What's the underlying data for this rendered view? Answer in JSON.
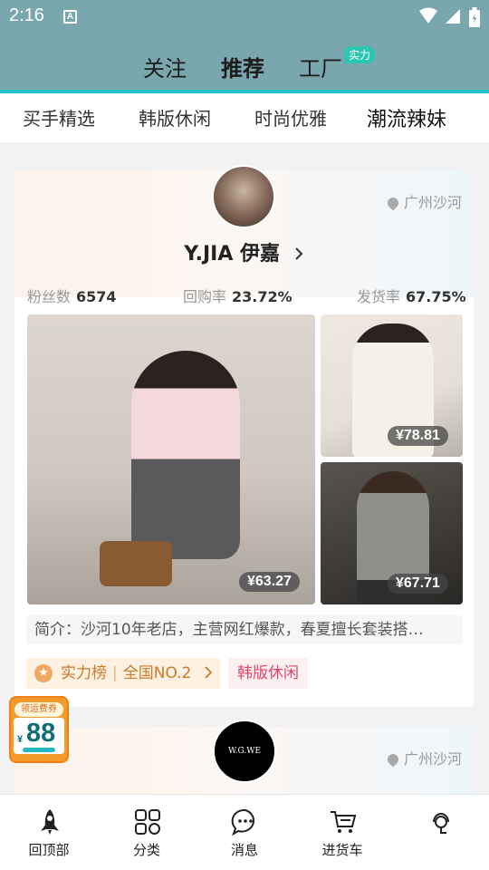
{
  "status_bar": {
    "time": "2:16",
    "notif_icon_letter": "A"
  },
  "top_tabs": [
    {
      "label": "关注"
    },
    {
      "label": "推荐"
    },
    {
      "label": "工厂"
    }
  ],
  "top_badge": "实力",
  "categories": [
    {
      "label": "买手精选"
    },
    {
      "label": "韩版休闲"
    },
    {
      "label": "时尚优雅"
    },
    {
      "label": "潮流辣妹"
    }
  ],
  "shop": {
    "location": "广州沙河",
    "name": "Y.JIA 伊嘉",
    "stats": [
      {
        "label": "粉丝数",
        "value": "6574"
      },
      {
        "label": "回购率",
        "value": "23.72%"
      },
      {
        "label": "发货率",
        "value": "67.75%"
      }
    ],
    "products": [
      {
        "price": "¥63.27"
      },
      {
        "price": "¥78.81"
      },
      {
        "price": "¥67.71"
      }
    ],
    "intro": "简介：沙河10年老店，主营网红爆款，春夏擅长套装搭…",
    "rank_label": "实力榜",
    "rank_value": "全国NO.2",
    "style_tag": "韩版休闲"
  },
  "shop2": {
    "avatar_text": "W.G.WE",
    "location": "广州沙河"
  },
  "coupon": {
    "title": "领运费券",
    "currency": "¥",
    "amount": "88"
  },
  "bottom_nav": [
    {
      "label": "回顶部",
      "icon": "rocket-icon"
    },
    {
      "label": "分类",
      "icon": "category-icon"
    },
    {
      "label": "消息",
      "icon": "message-icon"
    },
    {
      "label": "进货车",
      "icon": "cart-icon"
    },
    {
      "label": "",
      "icon": "service-icon"
    }
  ],
  "colors": {
    "header_bg": "#7aa6ad",
    "accent_teal": "#26c1c4",
    "rank_orange": "#c97a2a",
    "tag_pink": "#e0466a"
  }
}
